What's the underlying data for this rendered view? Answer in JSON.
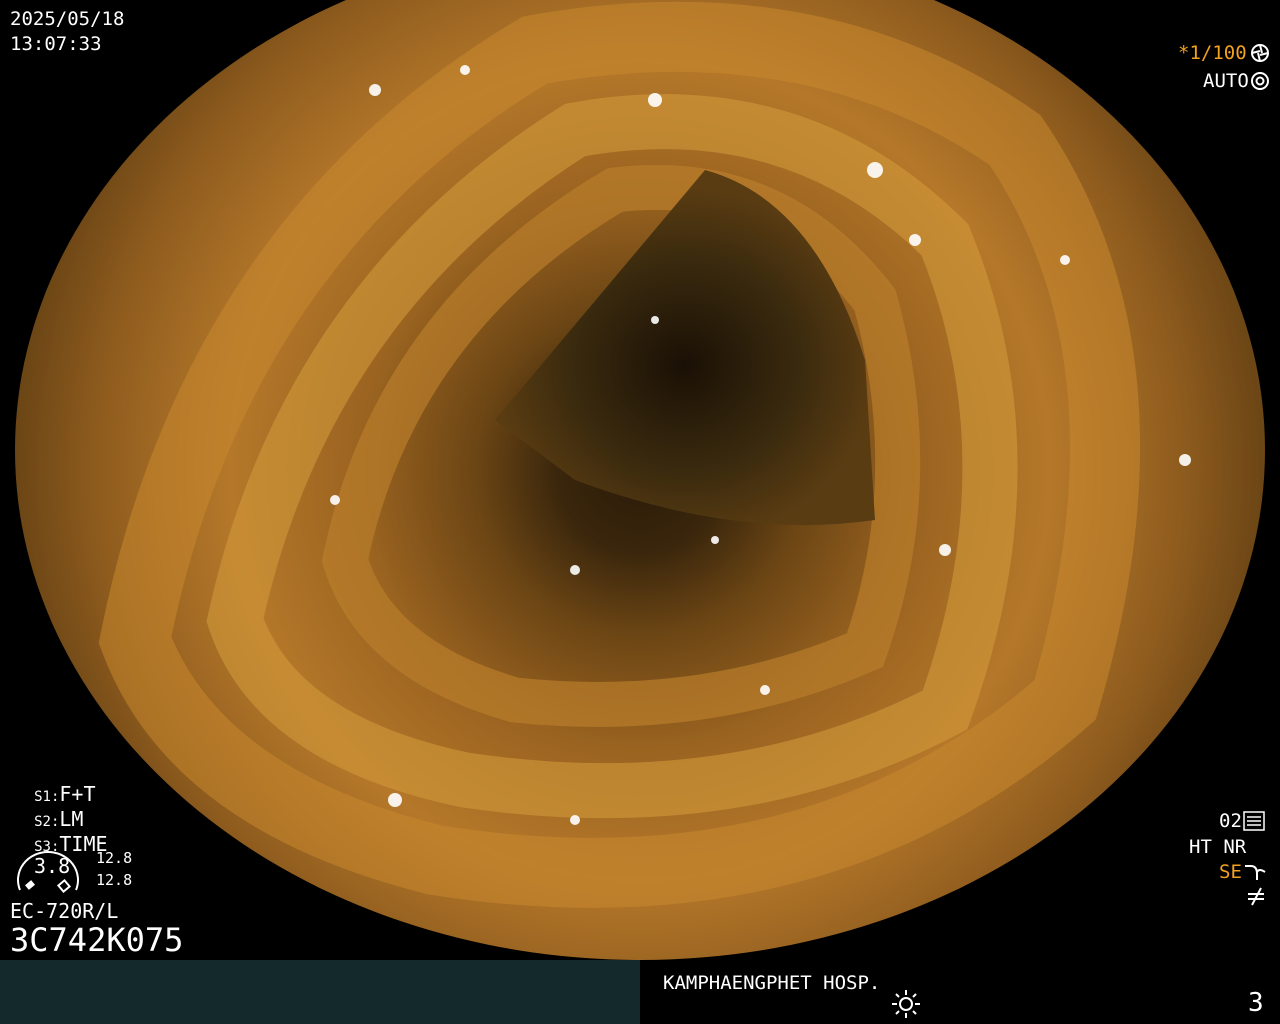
{
  "header": {
    "date": "2025/05/18",
    "time": "13:07:33"
  },
  "top_right": {
    "shutter": "*1/100",
    "mode": "AUTO",
    "shutter_icon": "aperture-icon",
    "mode_icon": "iris-icon"
  },
  "settings": {
    "s1_key": "S1:",
    "s1_val": "F+T",
    "s2_key": "S2:",
    "s2_val": "LM",
    "s3_key": "S3:",
    "s3_val": "TIME",
    "gauge_value": "3.8",
    "side_top": "12.8",
    "side_bottom": "12.8"
  },
  "scope": {
    "model": "EC-720R/L",
    "serial": "3C742K075"
  },
  "bottom_right_status": {
    "mode_num": "02",
    "ht_nr": "HT NR",
    "se": "SE",
    "se_icon": "curve-icon",
    "freeze_icon": "not-equal-icon",
    "settings_icon": "sliders-icon"
  },
  "footer": {
    "hospital": "KAMPHAENGPHET HOSP.",
    "brightness_icon": "sun-icon",
    "count": "3"
  },
  "colors": {
    "accent_orange": "#f2a020",
    "footer_teal": "#13292b"
  }
}
